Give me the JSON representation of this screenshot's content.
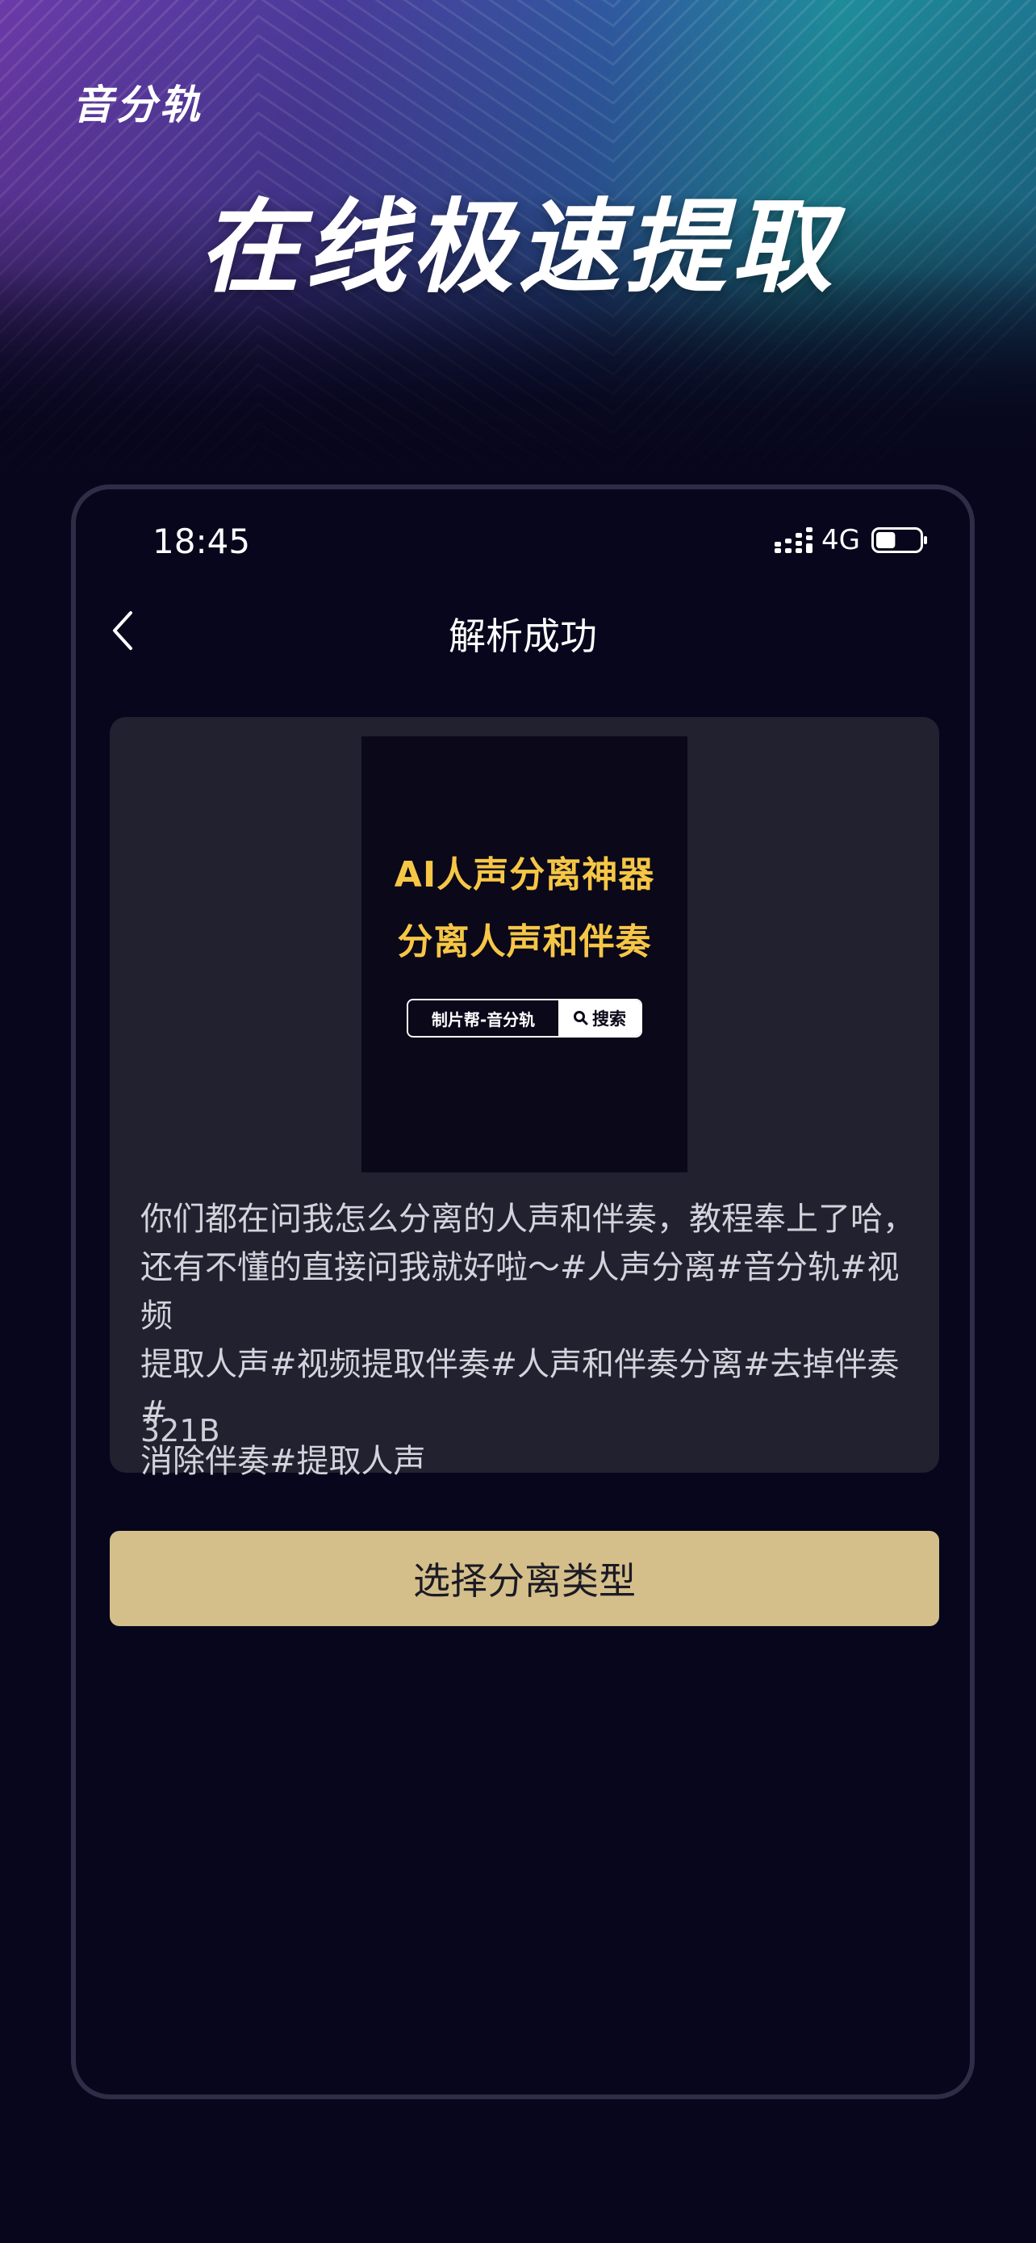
{
  "hero": {
    "brand": "音分轨",
    "headline": "在线极速提取"
  },
  "status_bar": {
    "time": "18:45",
    "network": "4G",
    "signal_icon": "signal-bars-icon",
    "battery_icon": "battery-icon",
    "battery_level": 0.45
  },
  "nav": {
    "back_icon": "chevron-left-icon",
    "title": "解析成功"
  },
  "result": {
    "thumbnail": {
      "line1": "AI人声分离神器",
      "line2": "分离人声和伴奏",
      "search_text": "制片帮-音分轨",
      "search_button": "搜索",
      "search_icon": "magnifier-icon"
    },
    "description": "你们都在问我怎么分离的人声和伴奏，教程奉上了哈，\n还有不懂的直接问我就好啦～#人声分离#音分轨#视频\n提取人声#视频提取伴奏#人声和伴奏分离#去掉伴奏#\n消除伴奏#提取人声",
    "size": "321B"
  },
  "action": {
    "label": "选择分离类型"
  },
  "colors": {
    "background": "#07061c",
    "card": "#22212f",
    "accent_button": "#d4bf8b",
    "thumb_title": "#f6c646",
    "phone_border": "#2e2d48"
  }
}
